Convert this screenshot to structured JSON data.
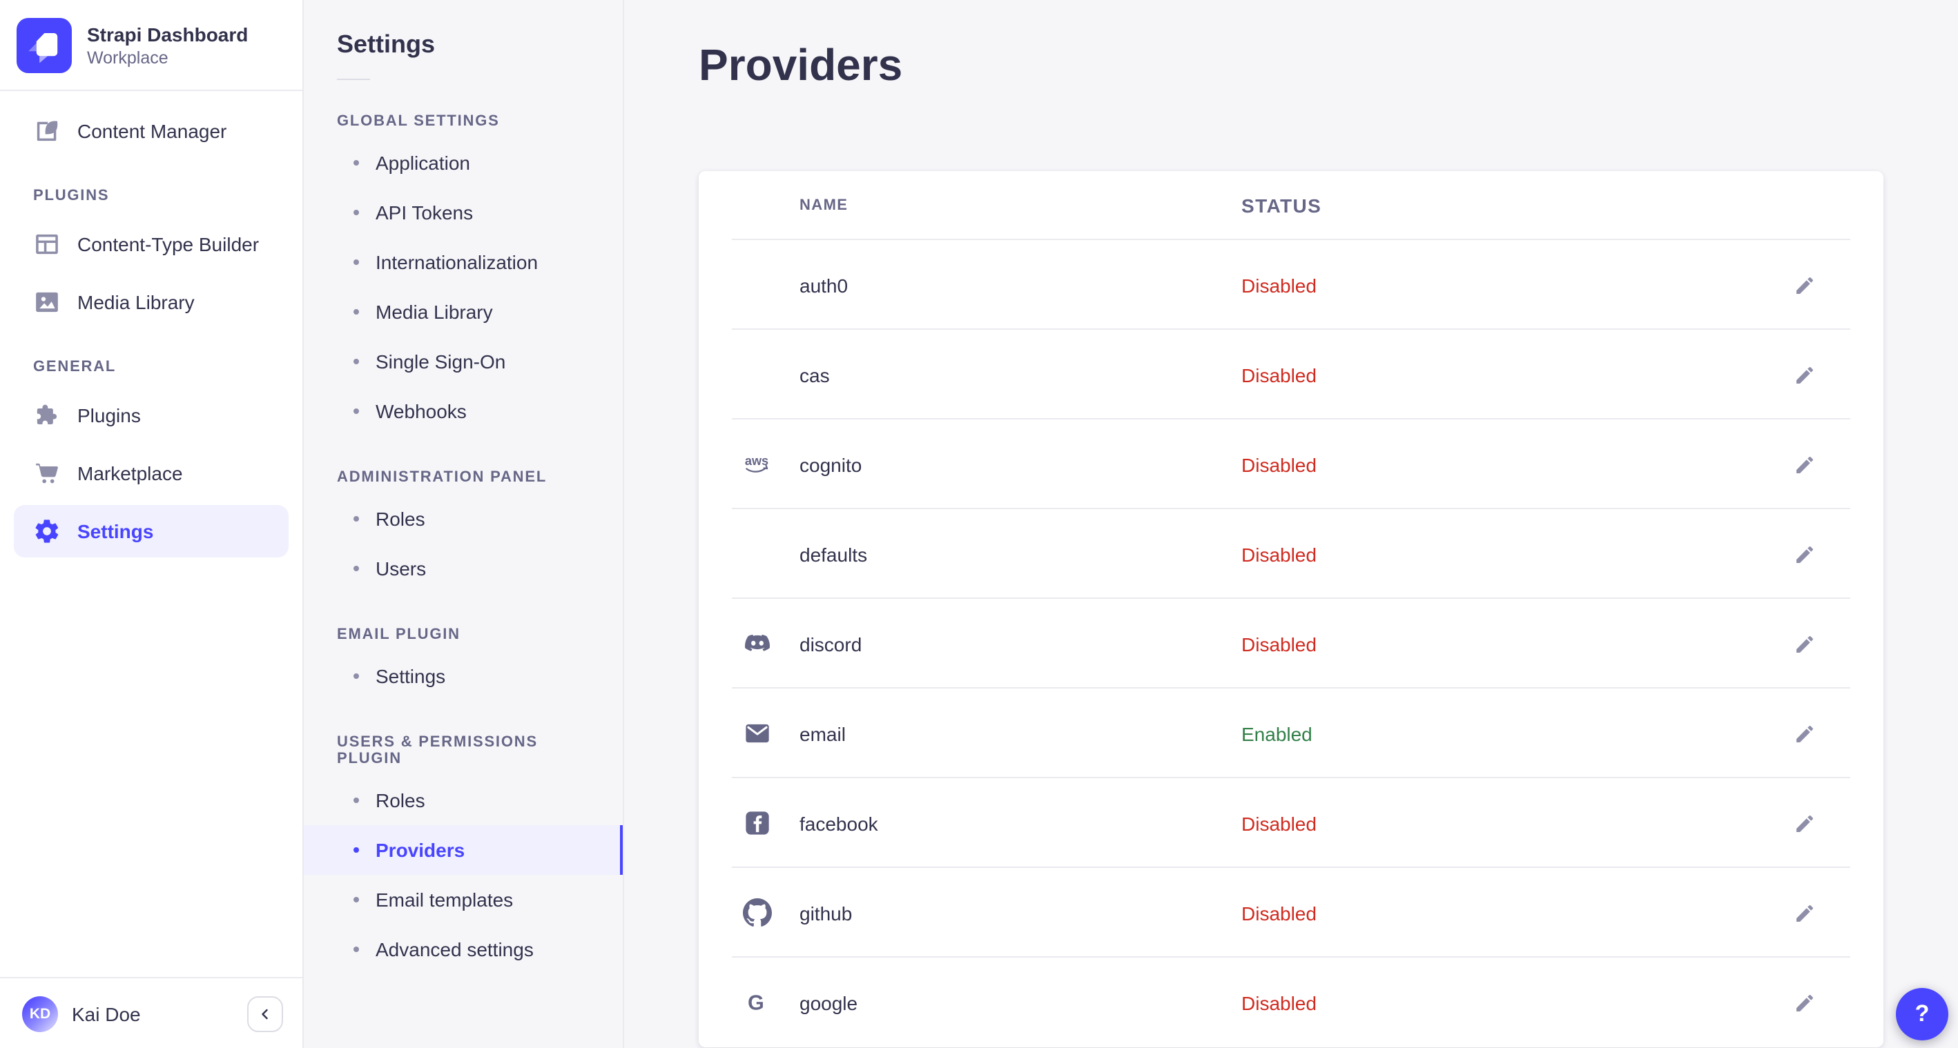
{
  "sidebar": {
    "brand": {
      "title": "Strapi Dashboard",
      "subtitle": "Workplace"
    },
    "primary": [
      {
        "label": "Content Manager",
        "icon": "content-manager"
      }
    ],
    "sections": [
      {
        "label": "PLUGINS",
        "items": [
          {
            "label": "Content-Type Builder",
            "icon": "content-type-builder"
          },
          {
            "label": "Media Library",
            "icon": "media-library"
          }
        ]
      },
      {
        "label": "GENERAL",
        "items": [
          {
            "label": "Plugins",
            "icon": "plugins"
          },
          {
            "label": "Marketplace",
            "icon": "marketplace"
          },
          {
            "label": "Settings",
            "icon": "settings",
            "active": true
          }
        ]
      }
    ],
    "user": {
      "name": "Kai Doe",
      "initials": "KD"
    }
  },
  "settings_nav": {
    "title": "Settings",
    "sections": [
      {
        "label": "GLOBAL SETTINGS",
        "items": [
          {
            "label": "Application"
          },
          {
            "label": "API Tokens"
          },
          {
            "label": "Internationalization"
          },
          {
            "label": "Media Library"
          },
          {
            "label": "Single Sign-On"
          },
          {
            "label": "Webhooks"
          }
        ]
      },
      {
        "label": "ADMINISTRATION PANEL",
        "items": [
          {
            "label": "Roles"
          },
          {
            "label": "Users"
          }
        ]
      },
      {
        "label": "EMAIL PLUGIN",
        "items": [
          {
            "label": "Settings"
          }
        ]
      },
      {
        "label": "USERS & PERMISSIONS PLUGIN",
        "items": [
          {
            "label": "Roles"
          },
          {
            "label": "Providers",
            "active": true
          },
          {
            "label": "Email templates"
          },
          {
            "label": "Advanced settings"
          }
        ]
      }
    ]
  },
  "main": {
    "title": "Providers",
    "help_label": "?",
    "table": {
      "columns": [
        "NAME",
        "STATUS"
      ],
      "rows": [
        {
          "name": "auth0",
          "icon": "none",
          "status": "Disabled"
        },
        {
          "name": "cas",
          "icon": "none",
          "status": "Disabled"
        },
        {
          "name": "cognito",
          "icon": "aws",
          "status": "Disabled"
        },
        {
          "name": "defaults",
          "icon": "none",
          "status": "Disabled"
        },
        {
          "name": "discord",
          "icon": "discord",
          "status": "Disabled"
        },
        {
          "name": "email",
          "icon": "email",
          "status": "Enabled"
        },
        {
          "name": "facebook",
          "icon": "facebook",
          "status": "Disabled"
        },
        {
          "name": "github",
          "icon": "github",
          "status": "Disabled"
        },
        {
          "name": "google",
          "icon": "google",
          "status": "Disabled"
        }
      ]
    }
  },
  "colors": {
    "accent": "#4945ff",
    "accent_bg": "#f0f0ff",
    "status_disabled": "#d02b20",
    "status_enabled": "#328048",
    "background": "#f6f6f9",
    "card": "#ffffff",
    "border": "#eaeaef",
    "text": "#32324d",
    "text_muted": "#666687",
    "icon_muted": "#8e8ea9"
  }
}
